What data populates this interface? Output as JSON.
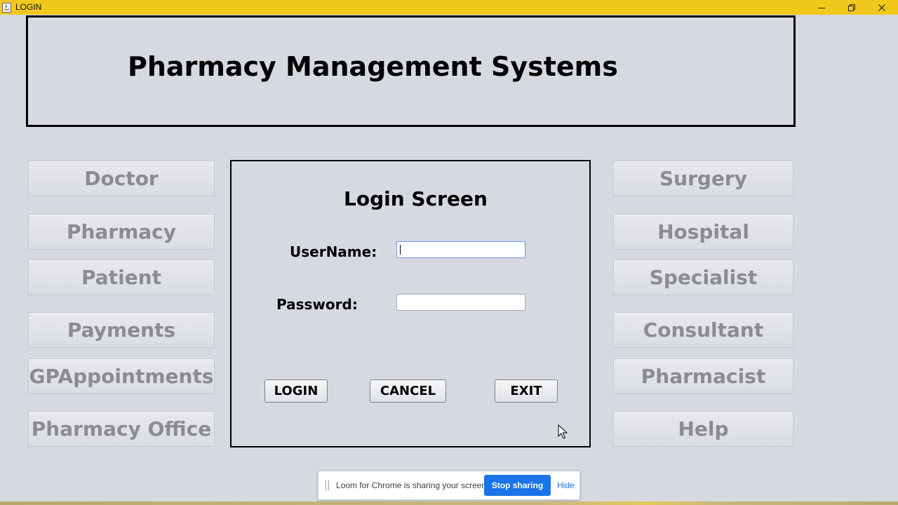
{
  "window": {
    "title": "LOGIN",
    "titlebar_color": "#f2c81d"
  },
  "header": {
    "title": "Pharmacy Management Systems"
  },
  "left_buttons": [
    {
      "label": "Doctor"
    },
    {
      "label": "Pharmacy"
    },
    {
      "label": "Patient"
    },
    {
      "label": "Payments"
    },
    {
      "label": "GPAppointments"
    },
    {
      "label": "Pharmacy Office"
    }
  ],
  "right_buttons": [
    {
      "label": "Surgery"
    },
    {
      "label": "Hospital"
    },
    {
      "label": "Specialist"
    },
    {
      "label": "Consultant"
    },
    {
      "label": "Pharmacist"
    },
    {
      "label": "Help"
    }
  ],
  "login": {
    "title": "Login Screen",
    "username_label": "UserName:",
    "username_value": "",
    "password_label": "Password:",
    "password_value": "",
    "login_button": "LOGIN",
    "cancel_button": "CANCEL",
    "exit_button": "EXIT"
  },
  "share_bar": {
    "message": "Loom for Chrome is sharing your screen.",
    "stop_label": "Stop sharing",
    "hide_label": "Hide",
    "accent": "#1a73e8"
  }
}
